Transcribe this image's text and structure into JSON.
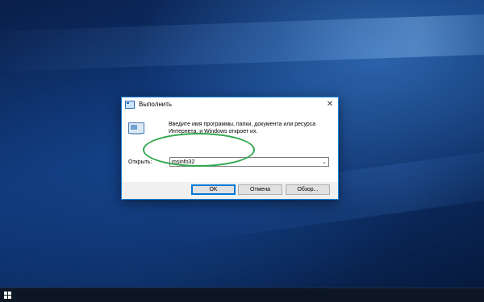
{
  "dialog": {
    "title": "Выполнить",
    "description": "Введите имя программы, папки, документа или ресурса Интернета, и Windows откроет их.",
    "open_label": "Открыть:",
    "open_value": "msinfo32",
    "buttons": {
      "ok": "OK",
      "cancel": "Отмена",
      "browse": "Обзор..."
    },
    "close_glyph": "✕",
    "dropdown_glyph": "⌄"
  },
  "colors": {
    "highlight": "#2fa84f",
    "accent": "#0078d7"
  },
  "icons": {
    "run": "run-app-icon",
    "start": "windows-logo-icon"
  }
}
